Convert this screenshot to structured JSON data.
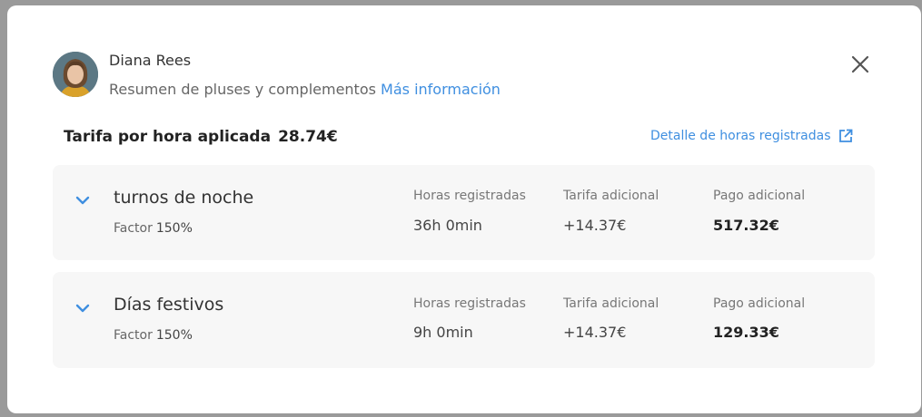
{
  "header": {
    "user_name": "Diana Rees",
    "subtitle": "Resumen de pluses y complementos",
    "more_info_link": "Más información"
  },
  "summary": {
    "rate_label": "Tarifa por hora aplicada",
    "rate_value": "28.74€",
    "detail_link": "Detalle de horas registradas"
  },
  "columns": {
    "hours": "Horas registradas",
    "extra_rate": "Tarifa adicional",
    "extra_pay": "Pago adicional"
  },
  "items": [
    {
      "title": "turnos de noche",
      "factor_label": "Factor",
      "factor_value": "150%",
      "hours": "36h 0min",
      "extra_rate": "+14.37€",
      "extra_pay": "517.32€"
    },
    {
      "title": "Días festivos",
      "factor_label": "Factor",
      "factor_value": "150%",
      "hours": "9h 0min",
      "extra_rate": "+14.37€",
      "extra_pay": "129.33€"
    }
  ],
  "icons": {
    "close": "close-icon",
    "external": "external-link-icon",
    "chevron": "chevron-down-icon"
  },
  "colors": {
    "accent": "#3f8fe0",
    "card_bg": "#f7f7f7",
    "backdrop": "#8f8f8f"
  }
}
